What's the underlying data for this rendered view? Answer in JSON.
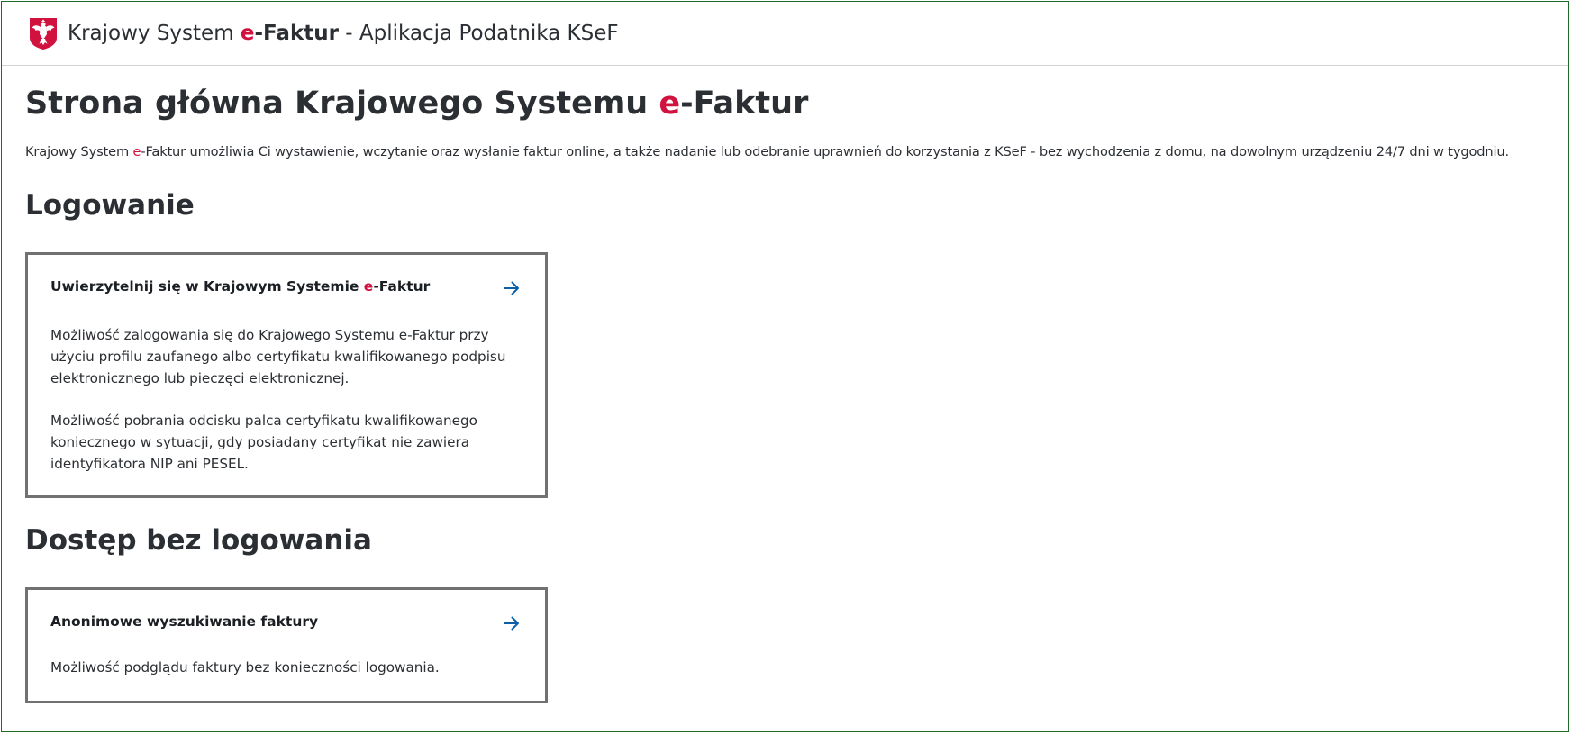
{
  "header": {
    "title_prefix": "Krajowy System ",
    "title_brand_e": "e",
    "title_brand_rest": "-Faktur",
    "title_suffix": " - Aplikacja Podatnika KSeF",
    "emblem_icon": "polish-eagle-emblem-icon"
  },
  "main": {
    "title_prefix": "Strona główna Krajowego Systemu ",
    "title_e": "e",
    "title_rest": "-Faktur",
    "intro_prefix": "Krajowy System ",
    "intro_e": "e",
    "intro_rest": "-Faktur umożliwia Ci wystawienie, wczytanie oraz wysłanie faktur online, a także nadanie lub odebranie uprawnień do korzystania z KSeF - bez wychodzenia z domu, na dowolnym urządzeniu 24/7 dni w tygodniu."
  },
  "login_section": {
    "heading": "Logowanie",
    "card": {
      "title_prefix": "Uwierzytelnij się w Krajowym Systemie ",
      "title_e": "e",
      "title_rest": "-Faktur",
      "paragraph1_line1": "Możliwość zalogowania się do Krajowego Systemu e-Faktur przy",
      "paragraph1_line2": "użyciu profilu zaufanego albo certyfikatu kwalifikowanego podpisu",
      "paragraph1_line3": "elektronicznego lub pieczęci elektronicznej.",
      "paragraph2_line1": "Możliwość pobrania odcisku palca certyfikatu kwalifikowanego",
      "paragraph2_line2": "koniecznego w sytuacji, gdy posiadany certyfikat nie zawiera",
      "paragraph2_line3": "identyfikatora NIP ani PESEL.",
      "arrow_icon": "arrow-right-icon"
    }
  },
  "anonymous_section": {
    "heading": "Dostęp bez logowania",
    "card": {
      "title": "Anonimowe wyszukiwanie faktury",
      "paragraph": "Możliwość podglądu faktury bez konieczności logowania.",
      "arrow_icon": "arrow-right-icon"
    }
  },
  "colors": {
    "accent_red": "#d1123f",
    "link_blue": "#0b5fa8",
    "text_dark": "#2b2f33",
    "card_border": "#6f7173",
    "frame_green": "#1f6b2a"
  }
}
